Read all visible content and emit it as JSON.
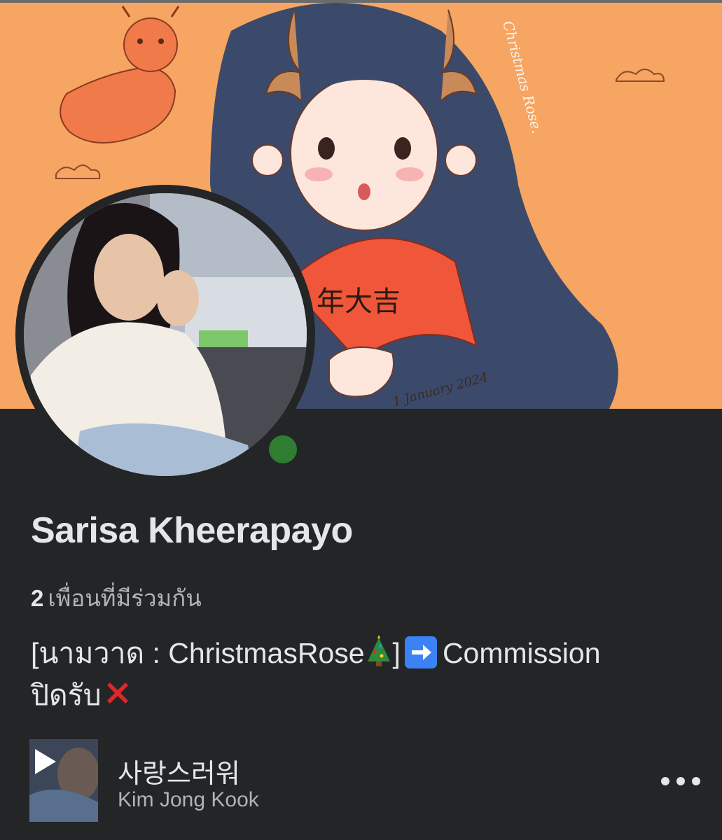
{
  "profile": {
    "name": "Sarisa Kheerapayo",
    "mutual_count": "2",
    "mutual_label": "เพื่อนที่มีร่วมกัน",
    "cover_text_signature": "Christmas Rose.",
    "cover_text_date": "1 January 2024",
    "cover_text_fan": "年大吉"
  },
  "bio": {
    "line1_prefix": "[นามวาด :  ChristmasRose",
    "line1_suffix": "]",
    "line1_end": "Commission",
    "line2": "ปิดรับ",
    "icons": [
      "christmas-tree-icon",
      "right-arrow-icon",
      "cross-mark-icon"
    ]
  },
  "music": {
    "title": "사랑스러워",
    "artist": "Kim Jong Kook",
    "icons": [
      "play-icon",
      "more-icon"
    ]
  },
  "colors": {
    "background": "#242526",
    "cover": "#f6a562",
    "text_primary": "#e4e6eb",
    "text_secondary": "#b0b3b8",
    "arrow_blue": "#3b82f6",
    "cross_red": "#e0262b"
  }
}
